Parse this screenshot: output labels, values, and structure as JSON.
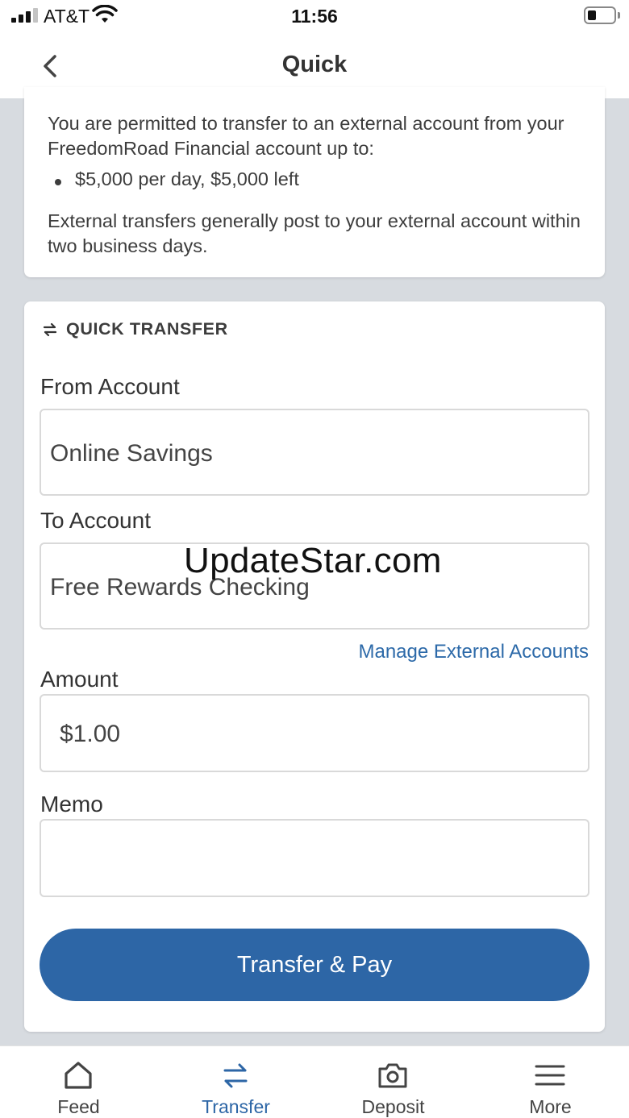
{
  "status_bar": {
    "carrier": "AT&T",
    "time": "11:56",
    "icons": [
      "signal-icon",
      "wifi-icon",
      "battery-icon"
    ]
  },
  "nav": {
    "title": "Quick",
    "back_icon": "chevron-left-icon"
  },
  "info": {
    "intro": "You are permitted to transfer to an external account from your FreedomRoad Financial account up to:",
    "limit_item": "$5,000 per day, $5,000 left",
    "note": "External transfers generally post to your external account within two business days."
  },
  "form": {
    "section_title": "QUICK TRANSFER",
    "section_icon": "swap-arrows-icon",
    "from_label": "From Account",
    "from_value": "Online Savings",
    "to_label": "To Account",
    "to_value": "Free Rewards Checking",
    "manage_link": "Manage External Accounts",
    "amount_label": "Amount",
    "amount_value": "$1.00",
    "memo_label": "Memo",
    "memo_value": "",
    "submit_label": "Transfer & Pay"
  },
  "watermark": "UpdateStar.com",
  "tabs": [
    {
      "label": "Feed",
      "icon": "home-icon",
      "active": false
    },
    {
      "label": "Transfer",
      "icon": "swap-arrows-icon",
      "active": true
    },
    {
      "label": "Deposit",
      "icon": "camera-icon",
      "active": false
    },
    {
      "label": "More",
      "icon": "menu-icon",
      "active": false
    }
  ],
  "colors": {
    "accent": "#2d66a6",
    "link": "#2d6aa9",
    "background": "#d7dbe0"
  }
}
